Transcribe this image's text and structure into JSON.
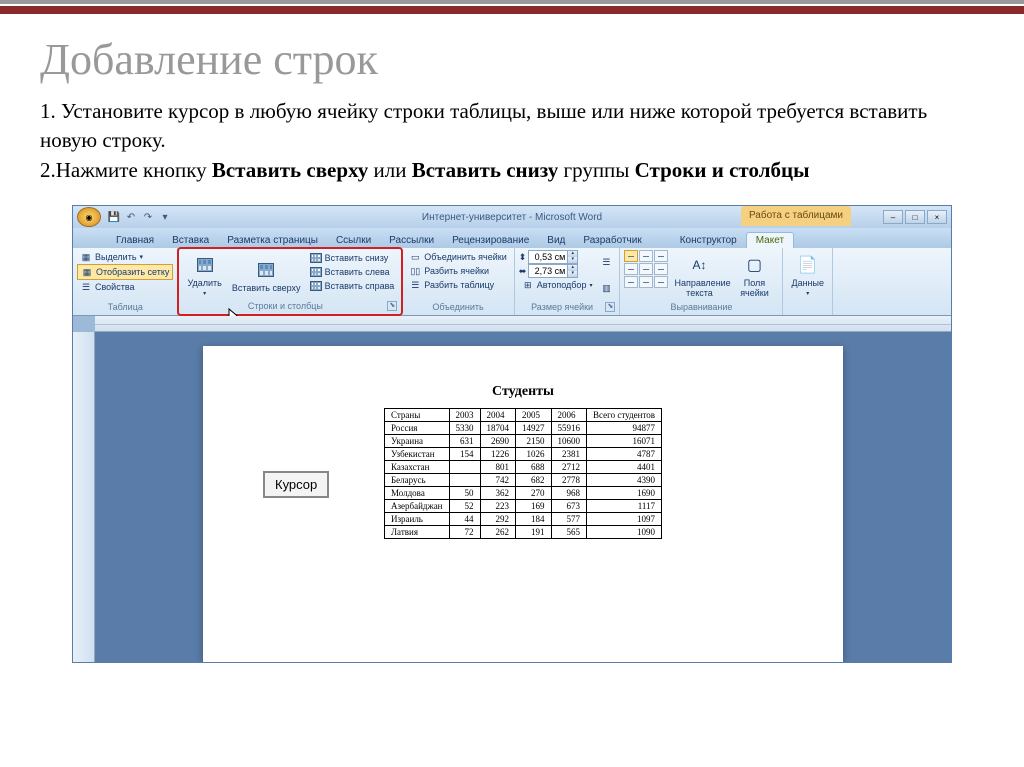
{
  "slide": {
    "title": "Добавление строк",
    "line1_a": "1. Установите курсор в любую ячейку строки таблицы, выше или ниже которой требуется вставить новую строку.",
    "line2_a": "2.Нажмите кнопку ",
    "line2_b": "Вставить сверху",
    "line2_c": " или ",
    "line2_d": "Вставить снизу",
    "line2_e": " группы ",
    "line2_f": "Строки и столбцы"
  },
  "word": {
    "title": "Интернет-университет - Microsoft Word",
    "context_title": "Работа с таблицами",
    "tabs": {
      "home": "Главная",
      "insert": "Вставка",
      "pagelayout": "Разметка страницы",
      "references": "Ссылки",
      "mailings": "Рассылки",
      "review": "Рецензирование",
      "view": "Вид",
      "developer": "Разработчик",
      "design": "Конструктор",
      "layout": "Макет"
    },
    "ribbon": {
      "table_group": {
        "select": "Выделить",
        "showgrid": "Отобразить сетку",
        "properties": "Свойства",
        "label": "Таблица"
      },
      "rowscols_group": {
        "delete": "Удалить",
        "insert_above": "Вставить сверху",
        "insert_below": "Вставить снизу",
        "insert_left": "Вставить слева",
        "insert_right": "Вставить справа",
        "label": "Строки и столбцы"
      },
      "merge_group": {
        "merge": "Объединить ячейки",
        "split": "Разбить ячейки",
        "split_table": "Разбить таблицу",
        "label": "Объединить"
      },
      "cellsize_group": {
        "height": "0,53 см",
        "width": "2,73 см",
        "autofit": "Автоподбор",
        "label": "Размер ячейки"
      },
      "align_group": {
        "textdir": "Направление текста",
        "margins": "Поля ячейки",
        "label": "Выравнивание"
      },
      "data_group": {
        "data": "Данные",
        "label": ""
      }
    }
  },
  "doc": {
    "heading": "Студенты",
    "cursor_label": "Курсор",
    "columns": [
      "Страны",
      "2003",
      "2004",
      "2005",
      "2006",
      "Всего студентов"
    ],
    "rows": [
      [
        "Россия",
        "5330",
        "18704",
        "14927",
        "55916",
        "94877"
      ],
      [
        "Украина",
        "631",
        "2690",
        "2150",
        "10600",
        "16071"
      ],
      [
        "Узбекистан",
        "154",
        "1226",
        "1026",
        "2381",
        "4787"
      ],
      [
        "Казахстан",
        "",
        "801",
        "688",
        "2712",
        "4401"
      ],
      [
        "Беларусь",
        "",
        "742",
        "682",
        "2778",
        "4390"
      ],
      [
        "Молдова",
        "50",
        "362",
        "270",
        "968",
        "1690"
      ],
      [
        "Азербайджан",
        "52",
        "223",
        "169",
        "673",
        "1117"
      ],
      [
        "Израиль",
        "44",
        "292",
        "184",
        "577",
        "1097"
      ],
      [
        "Латвия",
        "72",
        "262",
        "191",
        "565",
        "1090"
      ]
    ]
  }
}
